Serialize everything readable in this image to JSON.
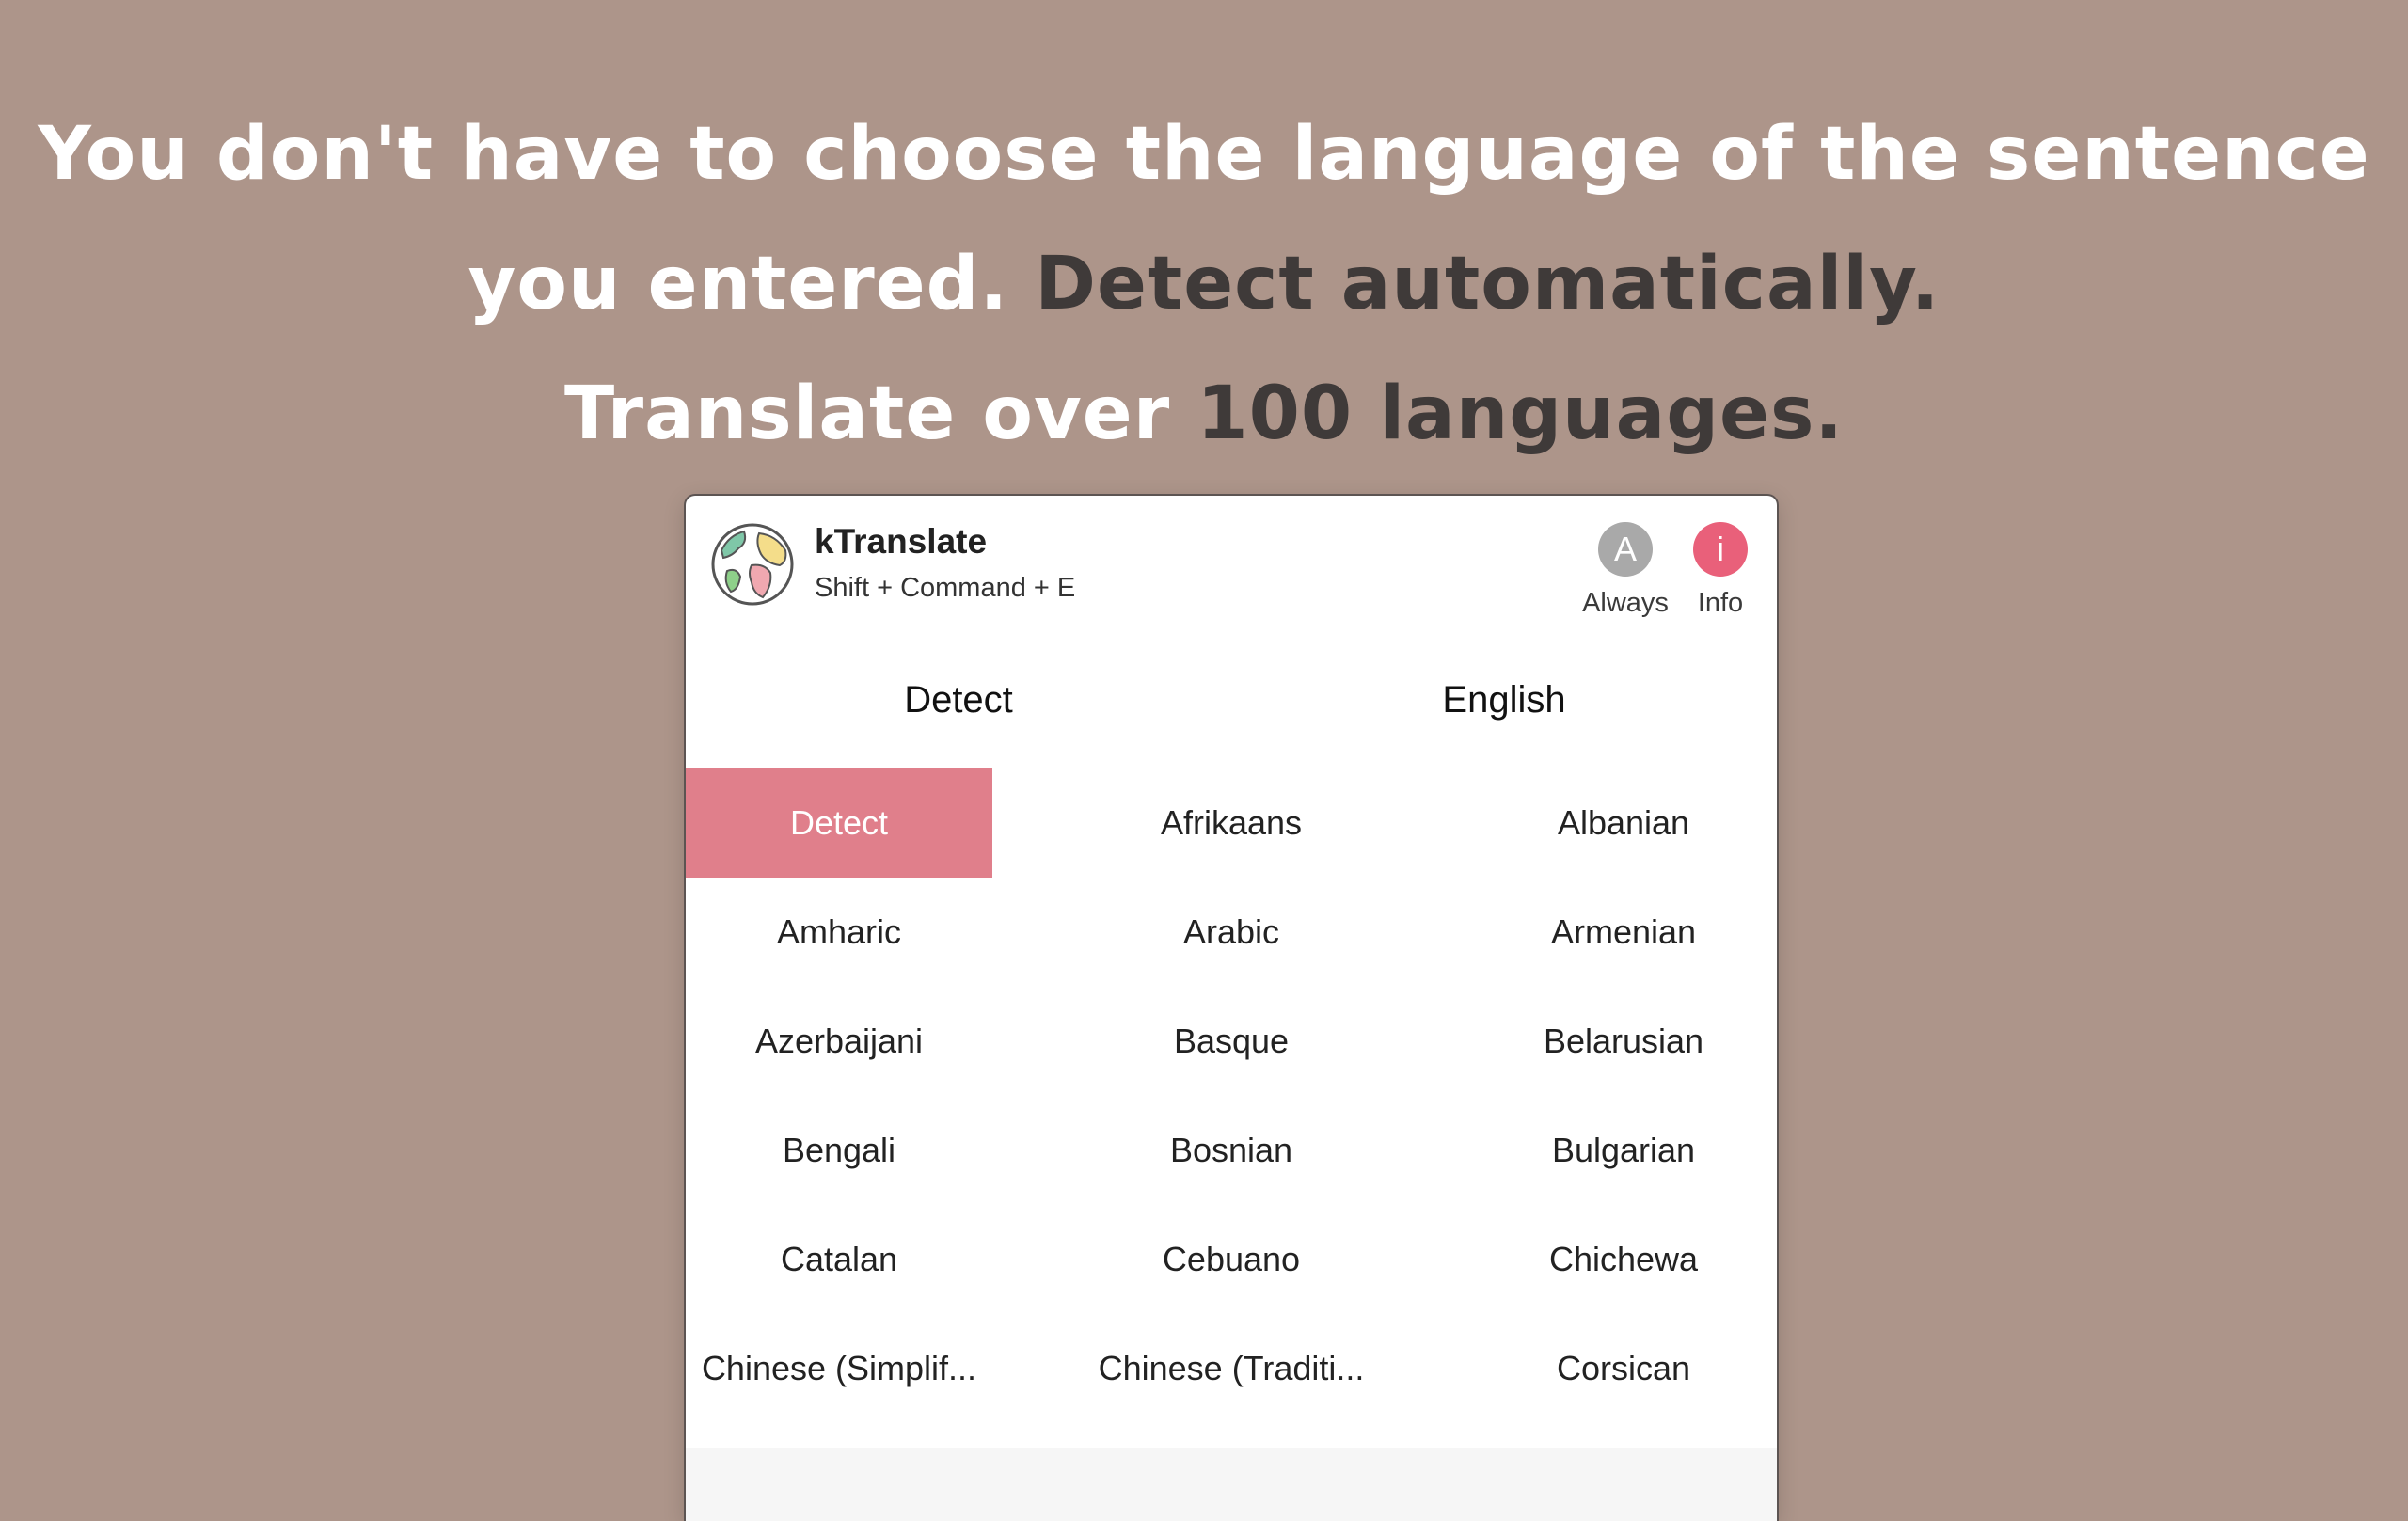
{
  "headline": {
    "line1": "You don't have to choose the language of the sentence",
    "line2_white": "you entered. ",
    "line2_dark": "Detect automatically.",
    "line3_white": "Translate over ",
    "line3_dark": "100 languages."
  },
  "app": {
    "name": "kTranslate",
    "shortcut": "Shift + Command + E",
    "always_icon": "A",
    "always_label": "Always",
    "info_icon": "i",
    "info_label": "Info"
  },
  "languages": {
    "source": "Detect",
    "target": "English",
    "selected": "Detect",
    "rows": [
      [
        "Detect",
        "Afrikaans",
        "Albanian"
      ],
      [
        "Amharic",
        "Arabic",
        "Armenian"
      ],
      [
        "Azerbaijani",
        "Basque",
        "Belarusian"
      ],
      [
        "Bengali",
        "Bosnian",
        "Bulgarian"
      ],
      [
        "Catalan",
        "Cebuano",
        "Chichewa"
      ],
      [
        "Chinese (Simplif...",
        "Chinese (Traditi...",
        "Corsican"
      ]
    ]
  },
  "colors": {
    "background": "#ad958a",
    "accent": "#e07f8b",
    "info": "#e9607a",
    "always": "#a9a9a9"
  }
}
